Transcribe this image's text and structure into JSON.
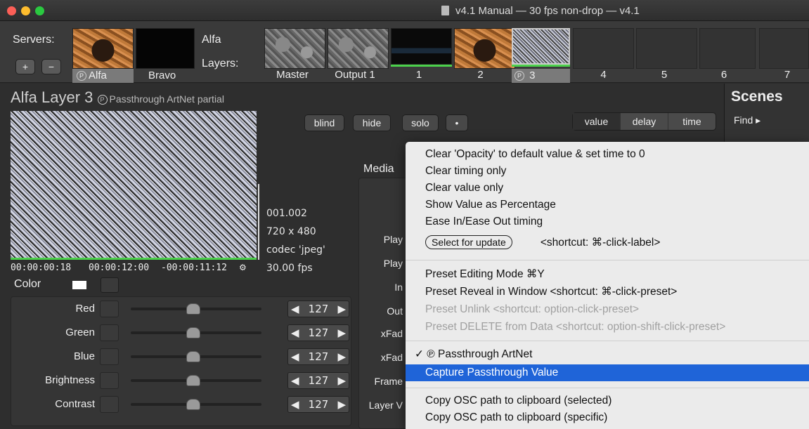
{
  "window": {
    "title": "v4.1 Manual  —  30 fps non-drop  —  v4.1"
  },
  "strip": {
    "servers_label": "Servers:",
    "layers_label": "Layers:",
    "current_server": "Alfa",
    "servers": [
      {
        "name": "Alfa",
        "selected": true
      },
      {
        "name": "Bravo",
        "selected": false
      }
    ],
    "layers": [
      "Master",
      "Output 1",
      "1",
      "2",
      "3",
      "4",
      "5",
      "6",
      "7"
    ],
    "add_symbol": "+",
    "remove_symbol": "−"
  },
  "layer": {
    "title": "Alfa Layer 3",
    "subtitle": "Passthrough ArtNet partial",
    "info": [
      "001.002",
      "720 x 480",
      "codec 'jpeg'",
      "30.00 fps"
    ],
    "time_current": "00:00:00:18",
    "time_total": "00:00:12:00",
    "time_remaining": "-00:00:11:12",
    "buttons": {
      "blind": "blind",
      "hide": "hide",
      "solo": "solo",
      "dot": "•"
    },
    "segments": [
      "value",
      "delay",
      "time"
    ],
    "color_label": "Color",
    "controls": [
      {
        "label": "Red",
        "value": "127"
      },
      {
        "label": "Green",
        "value": "127"
      },
      {
        "label": "Blue",
        "value": "127"
      },
      {
        "label": "Brightness",
        "value": "127"
      },
      {
        "label": "Contrast",
        "value": "127"
      }
    ],
    "media_label": "Media",
    "media_rows": [
      "Play",
      "Play",
      "In",
      "Out",
      "xFad",
      "xFad",
      "Frame",
      "Layer V"
    ]
  },
  "scenes": {
    "title": "Scenes",
    "find": "Find ▸"
  },
  "menu": {
    "items": [
      "Clear 'Opacity' to default value & set time to 0",
      "Clear timing only",
      "Clear value only",
      "Show Value as Percentage",
      "Ease In/Ease Out timing"
    ],
    "select_for_update": "Select for update",
    "select_shortcut": "<shortcut: ⌘-click-label>",
    "preset_editing": "Preset Editing Mode  ⌘Y",
    "preset_reveal": "Preset Reveal in Window  <shortcut: ⌘-click-preset>",
    "preset_unlink": "Preset Unlink       <shortcut: option-click-preset>",
    "preset_delete": "Preset DELETE from Data <shortcut: option-shift-click-preset>",
    "passthrough": "✓ ℗ Passthrough ArtNet",
    "capture": "Capture Passthrough Value",
    "copy_selected": "Copy OSC path to clipboard (selected)",
    "copy_specific": "Copy OSC path to clipboard (specific)"
  }
}
